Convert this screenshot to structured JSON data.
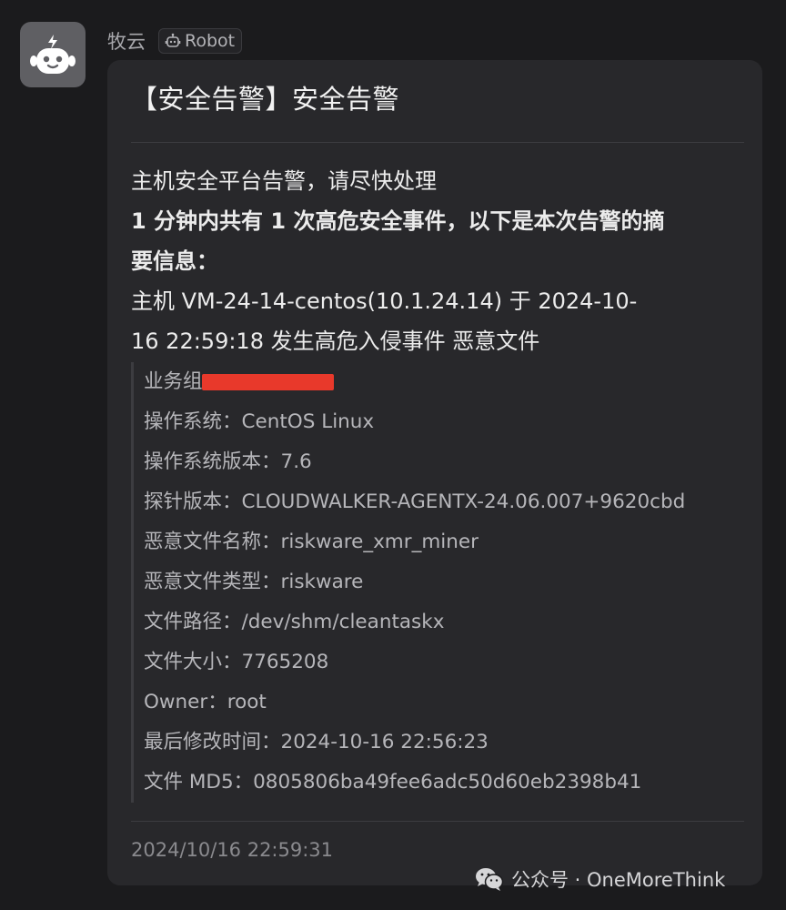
{
  "sender": {
    "name": "牧云",
    "tag_label": "Robot",
    "avatar_icon": "robot-icon"
  },
  "card": {
    "title": "【安全告警】安全告警",
    "summary_line1": "主机安全平台告警，请尽快处理",
    "summary_line2": "1 分钟内共有 1 次高危安全事件，以下是本次告警的摘",
    "summary_line3": "要信息：",
    "summary_line4": "主机 VM-24-14-centos(10.1.24.14) 于 2024-10-",
    "summary_line5": "16 22:59:18 发生高危入侵事件 恶意文件",
    "details": [
      {
        "label": "业务组：",
        "value": ""
      },
      {
        "label": "操作系统：",
        "value": "CentOS Linux"
      },
      {
        "label": "操作系统版本：",
        "value": "7.6"
      },
      {
        "label": "探针版本：",
        "value": "CLOUDWALKER-AGENTX-24.06.007+9620cbd"
      },
      {
        "label": "恶意文件名称：",
        "value": "riskware_xmr_miner"
      },
      {
        "label": "恶意文件类型：",
        "value": "riskware"
      },
      {
        "label": "文件路径：",
        "value": "/dev/shm/cleantaskx"
      },
      {
        "label": "文件大小：",
        "value": "7765208"
      },
      {
        "label": "Owner：",
        "value": "root"
      },
      {
        "label": "最后修改时间：",
        "value": "2024-10-16 22:56:23"
      },
      {
        "label": "文件 MD5：",
        "value": "0805806ba49fee6adc50d60eb2398b41"
      }
    ],
    "timestamp": "2024/10/16 22:59:31"
  },
  "watermark": {
    "text": "公众号 · OneMoreThink",
    "icon": "wechat-icon"
  },
  "colors": {
    "background": "#1b1b1d",
    "card": "#28282b",
    "redaction": "#e8392b"
  }
}
